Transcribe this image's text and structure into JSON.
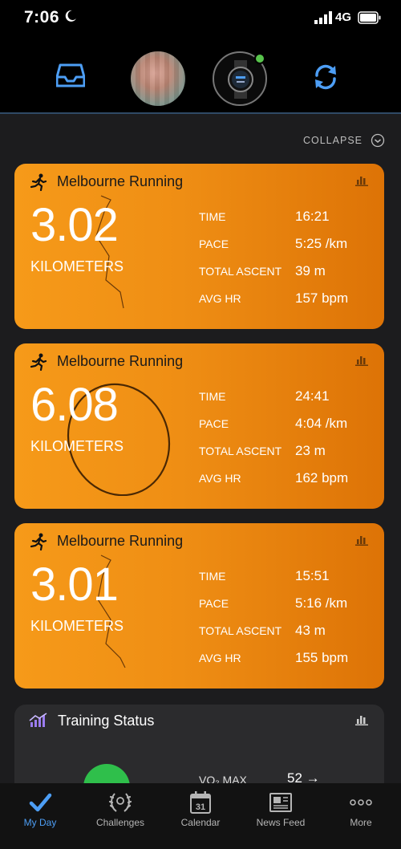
{
  "status_bar": {
    "time": "7:06",
    "network": "4G"
  },
  "header": {
    "collapse_label": "COLLAPSE"
  },
  "activities": [
    {
      "title": "Melbourne Running",
      "distance": "3.02",
      "unit": "KILOMETERS",
      "stats": [
        {
          "label": "TIME",
          "value": "16:21"
        },
        {
          "label": "PACE",
          "value": "5:25 /km"
        },
        {
          "label": "TOTAL ASCENT",
          "value": "39 m"
        },
        {
          "label": "AVG HR",
          "value": "157 bpm"
        }
      ]
    },
    {
      "title": "Melbourne Running",
      "distance": "6.08",
      "unit": "KILOMETERS",
      "stats": [
        {
          "label": "TIME",
          "value": "24:41"
        },
        {
          "label": "PACE",
          "value": "4:04 /km"
        },
        {
          "label": "TOTAL ASCENT",
          "value": "23 m"
        },
        {
          "label": "AVG HR",
          "value": "162 bpm"
        }
      ]
    },
    {
      "title": "Melbourne Running",
      "distance": "3.01",
      "unit": "KILOMETERS",
      "stats": [
        {
          "label": "TIME",
          "value": "15:51"
        },
        {
          "label": "PACE",
          "value": "5:16 /km"
        },
        {
          "label": "TOTAL ASCENT",
          "value": "43 m"
        },
        {
          "label": "AVG HR",
          "value": "155 bpm"
        }
      ]
    }
  ],
  "training": {
    "title": "Training Status",
    "vo2_label": "VO₂ MAX",
    "vo2_value": "52 →"
  },
  "tabs": [
    {
      "label": "My Day",
      "icon": "checkmark-icon",
      "active": true
    },
    {
      "label": "Challenges",
      "icon": "laurel-icon"
    },
    {
      "label": "Calendar",
      "icon": "calendar-icon",
      "day": "31"
    },
    {
      "label": "News Feed",
      "icon": "newspaper-icon"
    },
    {
      "label": "More",
      "icon": "more-dots-icon"
    }
  ],
  "colors": {
    "accent_blue": "#4d9ef5",
    "card_orange": "#f69a19",
    "green": "#2fbf4b",
    "background": "#1c1c1e"
  }
}
